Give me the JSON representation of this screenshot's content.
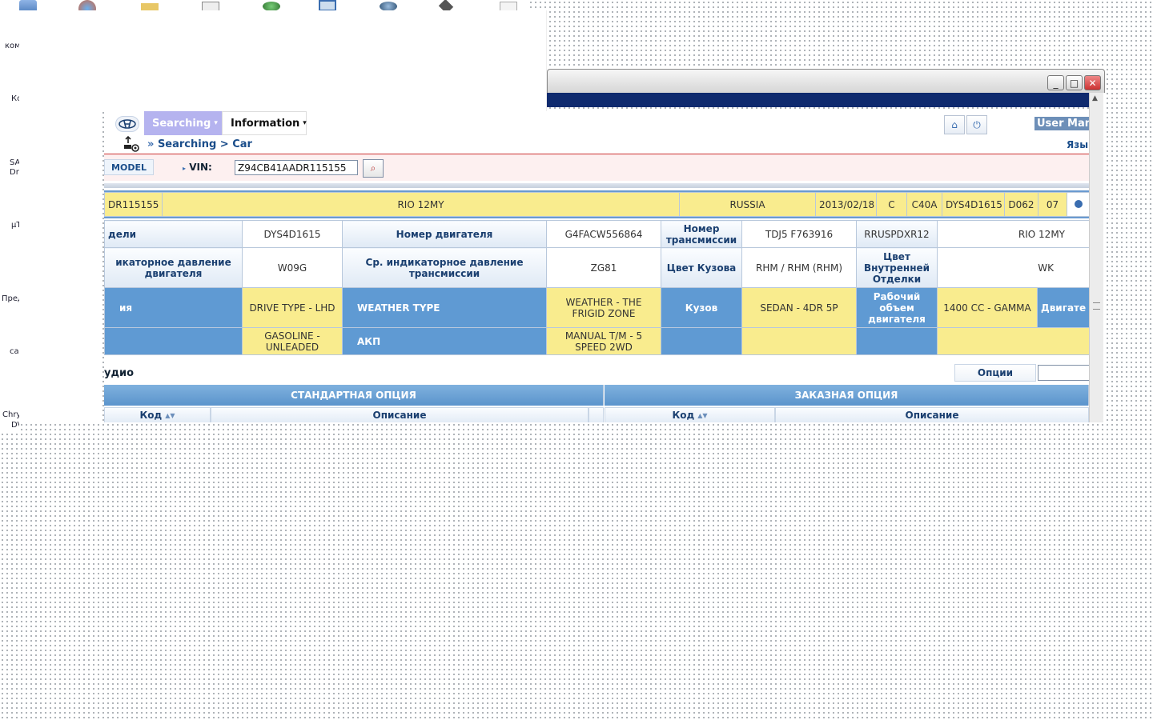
{
  "desktop": {
    "labels": [
      "ком",
      "Ко",
      "SA",
      "Dr",
      "µT",
      "Пред",
      "car",
      "Chry",
      "DV"
    ],
    "icon_names": [
      "computer-icon",
      "browser-icon",
      "folder-icon",
      "document-icon",
      "network-icon",
      "device-icon",
      "globe-icon",
      "app-icon",
      "file-icon"
    ]
  },
  "window": {
    "minimize": "_",
    "maximize": "□",
    "close": "✕"
  },
  "header": {
    "tabs": [
      {
        "label": "Searching",
        "active": true
      },
      {
        "label": "Information",
        "active": false
      }
    ],
    "chevron": "▾",
    "home_icon": "⌂",
    "power_icon": "⏻",
    "user_manual": "User Man",
    "language_label": "Язы"
  },
  "breadcrumb": {
    "prefix": "»",
    "text": "Searching > Car"
  },
  "search": {
    "model_tab": "MODEL",
    "vin_label": "VIN:",
    "vin_value": "Z94CB41AADR115155",
    "search_icon": "⌕"
  },
  "summary": [
    "DR115155",
    "RIO 12MY",
    "RUSSIA",
    "2013/02/18",
    "C",
    "C40A",
    "DYS4D1615",
    "D062",
    "07"
  ],
  "details": {
    "row1": {
      "model_label": "дели",
      "model_value": "DYS4D1615",
      "engine_no_label": "Номер двигателя",
      "engine_no_value": "G4FACW556864",
      "trans_no_label": "Номер трансмиссии",
      "trans_no_value": "TDJ5 F763916",
      "code_value": "RRUSPDXR12",
      "model_name_value": "RIO 12MY"
    },
    "row2": {
      "engine_pressure_label": "икаторное давление двигателя",
      "engine_pressure_value": "W09G",
      "trans_pressure_label": "Ср. индикаторное давление трансмиссии",
      "trans_pressure_value": "ZG81",
      "body_color_label": "Цвет Кузова",
      "body_color_value": "RHM / RHM (RHM)",
      "interior_label": "Цвет Внутренней Отделки",
      "interior_value": "WK"
    },
    "row3": {
      "first_label": "ия",
      "drive_type": "DRIVE TYPE - LHD",
      "weather_label": "WEATHER TYPE",
      "weather_value": "WEATHER - THE FRIGID ZONE",
      "body_label": "Кузов",
      "body_value": "SEDAN - 4DR 5P",
      "displacement_label": "Рабочий объем двигателя",
      "displacement_value": "1400 CC - GAMMA",
      "engine_label": "Двигате"
    },
    "row4": {
      "fuel_value": "GASOLINE - UNLEADED",
      "akp_label": "АКП",
      "akp_value": "MANUAL T/M - 5 SPEED 2WD"
    }
  },
  "options": {
    "section_title": "удио",
    "options_button": "Опции",
    "standard_header": "СТАНДАРТНАЯ ОПЦИЯ",
    "custom_header": "ЗАКАЗНАЯ ОПЦИЯ",
    "code_col": "Код",
    "desc_col": "Описание",
    "sort_icon": "▲▼"
  },
  "colors": {
    "accent_tab": "#b5b3ef",
    "yellow_cell": "#f9ec8e",
    "blue_label": "#5f9ad3",
    "navy_bar": "#0f2a6e"
  }
}
